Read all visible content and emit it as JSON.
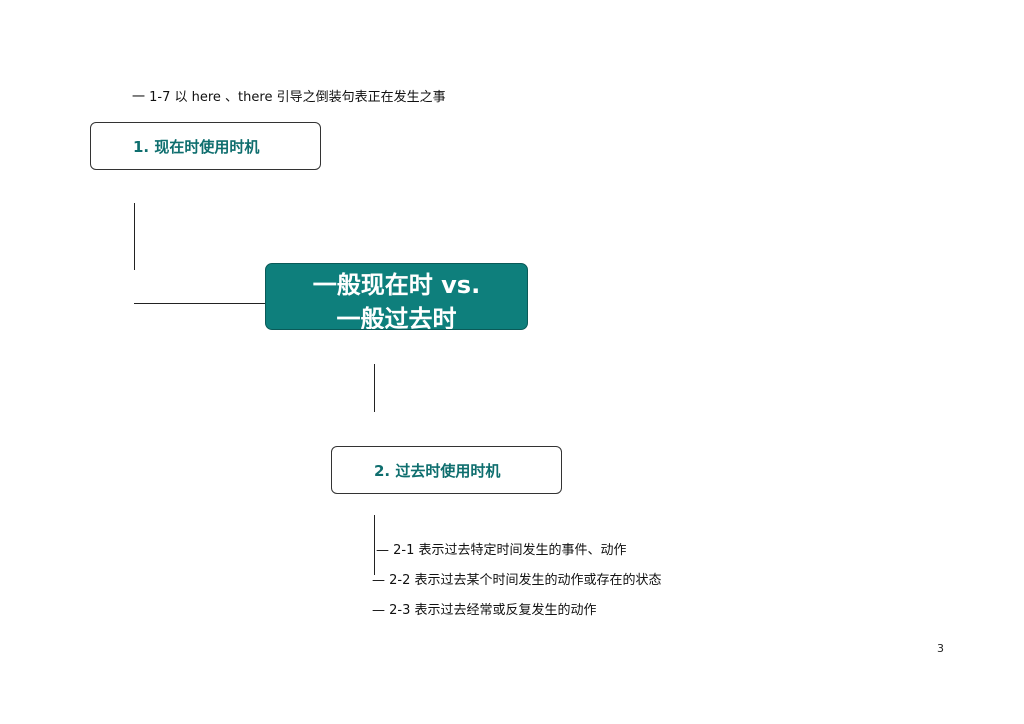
{
  "header_note": "一 1-7 以 here 、there 引导之倒装句表正在发生之事",
  "box1": {
    "label": "1. 现在时使用时机"
  },
  "center": {
    "line1": "一般现在时 vs.",
    "line2": "一般过去时"
  },
  "box2": {
    "label": "2. 过去时使用时机"
  },
  "sub_items": [
    {
      "label": "2-1 表示过去特定时间发生的事件、动作"
    },
    {
      "label": "2-2 表示过去某个时间发生的动作或存在的状态"
    },
    {
      "label": "2-3 表示过去经常或反复发生的动作"
    }
  ],
  "page_number": "3"
}
